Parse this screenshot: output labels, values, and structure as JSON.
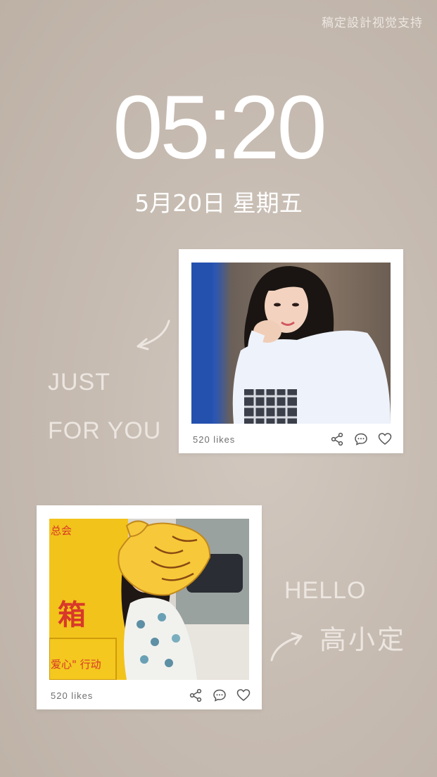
{
  "watermark": "稿定設計视觉支持",
  "clock": {
    "time": "05:20",
    "date": "5月20日 星期五"
  },
  "cards": [
    {
      "likes": "520 likes",
      "icons": [
        "share-icon",
        "comment-icon",
        "heart-icon"
      ]
    },
    {
      "likes": "520 likes",
      "icons": [
        "share-icon",
        "comment-icon",
        "heart-icon"
      ]
    }
  ],
  "captions": {
    "just": "JUST",
    "for_you": "FOR YOU",
    "hello": "HELLO",
    "name": "高小定"
  },
  "photo2_sign": {
    "top": "总会",
    "char": "箱",
    "bottom": "爱心\" 行动"
  },
  "colors": {
    "background": "#c7bcb2",
    "text_light": "#ece6e1",
    "card": "#ffffff"
  }
}
